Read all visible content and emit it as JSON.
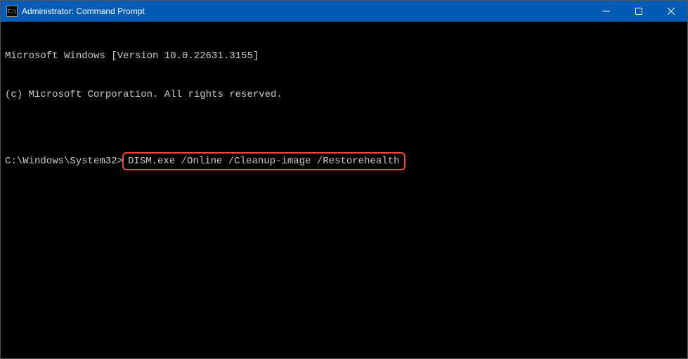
{
  "titlebar": {
    "icon_label": "C:\\",
    "title": "Administrator: Command Prompt"
  },
  "terminal": {
    "line1": "Microsoft Windows [Version 10.0.22631.3155]",
    "line2": "(c) Microsoft Corporation. All rights reserved.",
    "blank": "",
    "prompt": "C:\\Windows\\System32>",
    "command": "DISM.exe /Online /Cleanup-image /Restorehealth"
  },
  "window_controls": {
    "minimize": "minimize",
    "maximize": "maximize",
    "close": "close"
  }
}
